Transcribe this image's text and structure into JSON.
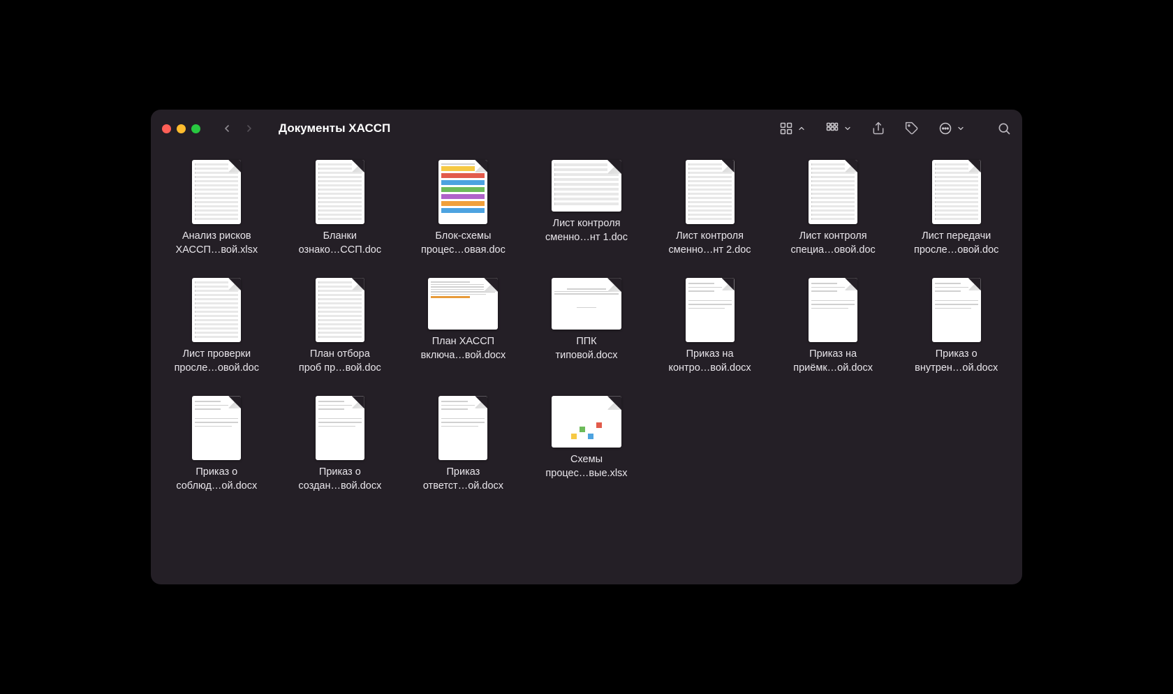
{
  "window": {
    "title": "Документы ХАССП"
  },
  "files": [
    {
      "name_line1": "Анализ рисков",
      "name_line2": "ХАССП…вой.xlsx",
      "thumb": "table"
    },
    {
      "name_line1": "Бланки",
      "name_line2": "ознако…ССП.doc",
      "thumb": "table"
    },
    {
      "name_line1": "Блок-схемы",
      "name_line2": "процес…овая.doc",
      "thumb": "colorful"
    },
    {
      "name_line1": "Лист контроля",
      "name_line2": "сменно…нт 1.doc",
      "thumb": "wide-table"
    },
    {
      "name_line1": "Лист контроля",
      "name_line2": "сменно…нт 2.doc",
      "thumb": "table"
    },
    {
      "name_line1": "Лист контроля",
      "name_line2": "специа…овой.doc",
      "thumb": "table"
    },
    {
      "name_line1": "Лист передачи",
      "name_line2": "просле…овой.doc",
      "thumb": "table"
    },
    {
      "name_line1": "Лист проверки",
      "name_line2": "просле…овой.doc",
      "thumb": "table"
    },
    {
      "name_line1": "План отбора",
      "name_line2": "проб пр…вой.doc",
      "thumb": "table"
    },
    {
      "name_line1": "План ХАССП",
      "name_line2": "включа…вой.docx",
      "thumb": "wide-text"
    },
    {
      "name_line1": "ППК",
      "name_line2": "типовой.docx",
      "thumb": "wide-sparse"
    },
    {
      "name_line1": "Приказ на",
      "name_line2": "контро…вой.docx",
      "thumb": "sparse"
    },
    {
      "name_line1": "Приказ на",
      "name_line2": "приёмк…ой.docx",
      "thumb": "sparse"
    },
    {
      "name_line1": "Приказ о",
      "name_line2": "внутрен…ой.docx",
      "thumb": "sparse"
    },
    {
      "name_line1": "Приказ о",
      "name_line2": "соблюд…ой.docx",
      "thumb": "sparse"
    },
    {
      "name_line1": "Приказ о",
      "name_line2": "создан…вой.docx",
      "thumb": "sparse"
    },
    {
      "name_line1": "Приказ",
      "name_line2": "ответст…ой.docx",
      "thumb": "sparse"
    },
    {
      "name_line1": "Схемы",
      "name_line2": "процес…вые.xlsx",
      "thumb": "wide-chart"
    }
  ]
}
